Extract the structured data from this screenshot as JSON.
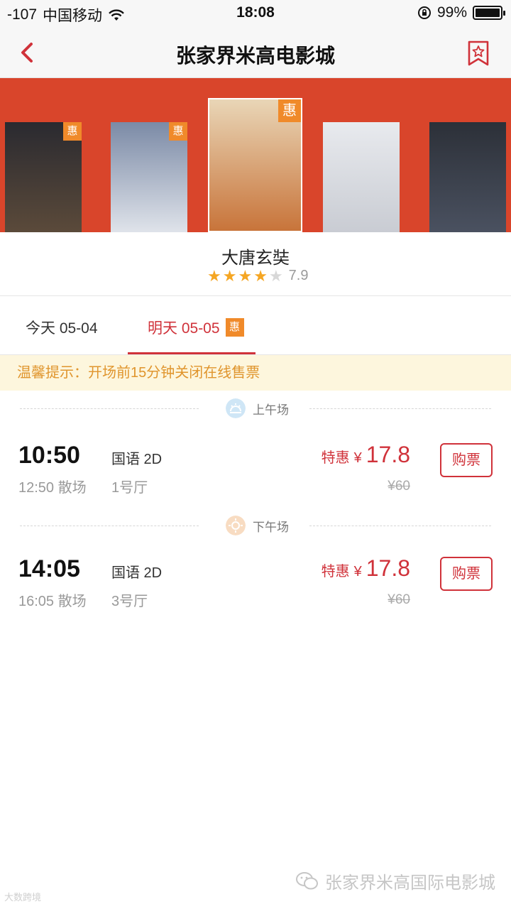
{
  "status_bar": {
    "signal": "-107",
    "carrier": "中国移动",
    "time": "18:08",
    "battery": "99%",
    "battery_level": 0.99
  },
  "nav": {
    "title": "张家界米高电影城",
    "back_icon": "chevron-left-icon",
    "favorite_icon": "bookmark-star-icon",
    "accent_color": "#d0323a"
  },
  "carousel": {
    "background_color": "#d9452b",
    "tag_label": "惠",
    "posters": [
      {
        "colors": [
          "#2a2a30",
          "#5b4a3a"
        ],
        "has_tag": true
      },
      {
        "colors": [
          "#7b8aa6",
          "#dfe3ea"
        ],
        "has_tag": true
      },
      {
        "colors": [
          "#e9d6b7",
          "#c8743a"
        ],
        "has_tag": true,
        "selected": true
      },
      {
        "colors": [
          "#e8eaee",
          "#c9ccd3"
        ],
        "has_tag": false
      },
      {
        "colors": [
          "#2c3038",
          "#4a5160"
        ],
        "has_tag": false
      }
    ]
  },
  "movie": {
    "name": "大唐玄奘",
    "stars": 4,
    "max_stars": 5,
    "score": "7.9"
  },
  "tabs": {
    "today": "今天 05-04",
    "tomorrow": "明天 05-05",
    "tomorrow_badge": "惠",
    "active": "tomorrow"
  },
  "notice": "温馨提示：开场前15分钟关闭在线售票",
  "periods": {
    "morning": "上午场",
    "afternoon": "下午场"
  },
  "sessions": [
    {
      "start": "10:50",
      "end": "12:50 散场",
      "language": "国语 2D",
      "hall": "1号厅",
      "price_label": "特惠",
      "currency": "¥",
      "price": "17.8",
      "original": "¥60",
      "buy_label": "购票"
    },
    {
      "start": "14:05",
      "end": "16:05 散场",
      "language": "国语 2D",
      "hall": "3号厅",
      "price_label": "特惠",
      "currency": "¥",
      "price": "17.8",
      "original": "¥60",
      "buy_label": "购票"
    }
  ],
  "watermark": {
    "text": "张家界米高国际电影城",
    "corner_text": "大数跨境"
  }
}
